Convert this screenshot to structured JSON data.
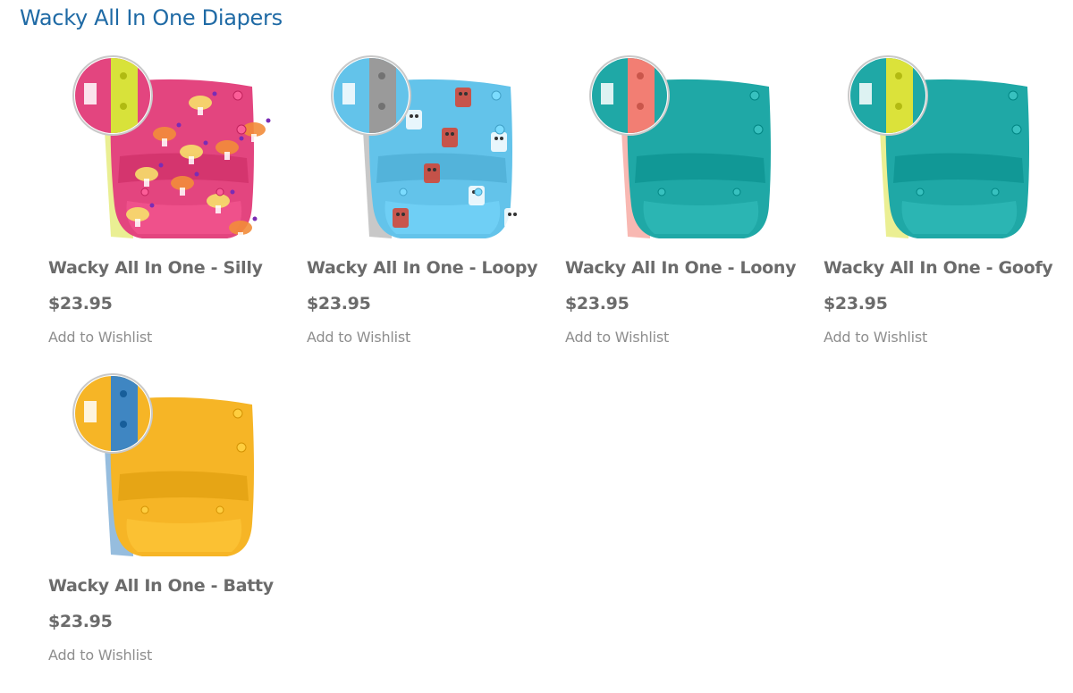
{
  "page": {
    "title": "Wacky All In One Diapers"
  },
  "products": [
    {
      "name": "Wacky All In One - Silly",
      "price": "$23.95",
      "wishlist": "Add to Wishlist",
      "body_color": "#e3457f",
      "tab_color": "#d8e23a",
      "pattern": "mushrooms"
    },
    {
      "name": "Wacky All In One - Loopy",
      "price": "$23.95",
      "wishlist": "Add to Wishlist",
      "body_color": "#63c3ea",
      "tab_color": "#9a9a9a",
      "pattern": "robots"
    },
    {
      "name": "Wacky All In One - Loony",
      "price": "$23.95",
      "wishlist": "Add to Wishlist",
      "body_color": "#1fa8a6",
      "tab_color": "#f27e73",
      "pattern": "solid"
    },
    {
      "name": "Wacky All In One - Goofy",
      "price": "$23.95",
      "wishlist": "Add to Wishlist",
      "body_color": "#1fa8a6",
      "tab_color": "#dbe23a",
      "pattern": "solid"
    },
    {
      "name": "Wacky All In One - Batty",
      "price": "$23.95",
      "wishlist": "Add to Wishlist",
      "body_color": "#f6b526",
      "tab_color": "#3f86c2",
      "pattern": "solid"
    }
  ]
}
